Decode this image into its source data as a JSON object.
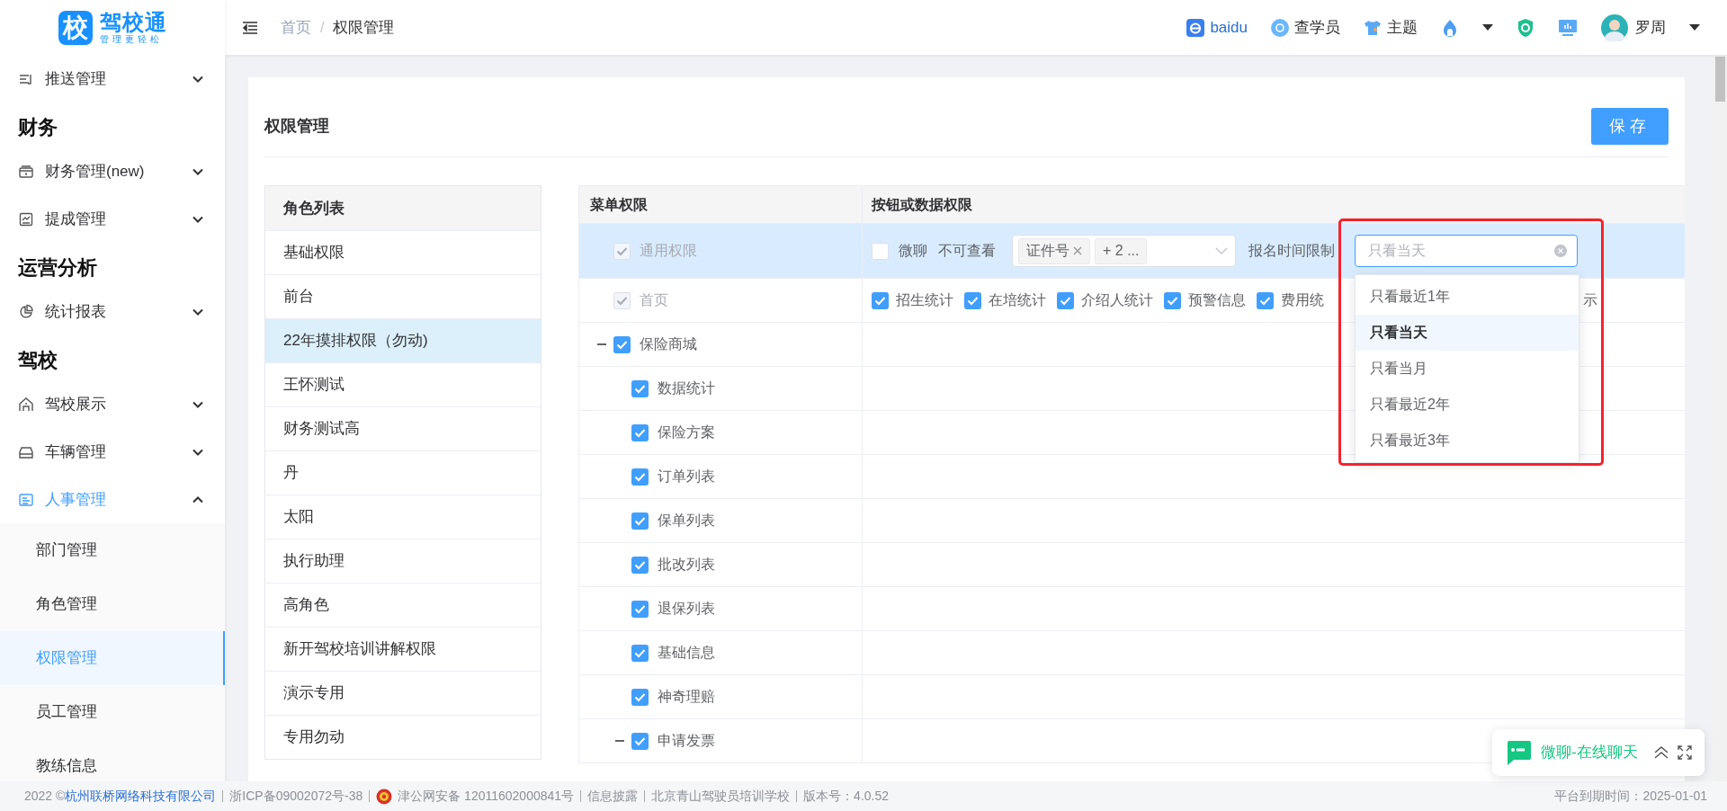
{
  "logo": {
    "mark": "校",
    "name": "驾校通",
    "tagline": "管理更轻松"
  },
  "header": {
    "breadcrumb": [
      "首页",
      "权限管理"
    ],
    "breadcrumb_separator": "/",
    "links": [
      {
        "label": "baidu",
        "kind": "link"
      },
      {
        "label": "查学员",
        "kind": "action"
      },
      {
        "label": "主题",
        "kind": "action"
      }
    ],
    "user": {
      "name": "罗周"
    }
  },
  "sidebar": {
    "sections": [
      {
        "items": [
          {
            "label": "推送管理",
            "expanded": false
          }
        ]
      },
      {
        "title": "财务",
        "items": [
          {
            "label": "财务管理(new)",
            "expanded": false
          },
          {
            "label": "提成管理",
            "expanded": false
          }
        ]
      },
      {
        "title": "运营分析",
        "items": [
          {
            "label": "统计报表",
            "expanded": false
          }
        ]
      },
      {
        "title": "驾校",
        "items": [
          {
            "label": "驾校展示",
            "expanded": false
          },
          {
            "label": "车辆管理",
            "expanded": false
          },
          {
            "label": "人事管理",
            "expanded": true,
            "children": [
              {
                "label": "部门管理",
                "selected": false
              },
              {
                "label": "角色管理",
                "selected": false
              },
              {
                "label": "权限管理",
                "selected": true
              },
              {
                "label": "员工管理",
                "selected": false
              },
              {
                "label": "教练信息",
                "selected": false
              }
            ]
          }
        ]
      }
    ]
  },
  "page": {
    "title": "权限管理",
    "save_button": "保存"
  },
  "roles": {
    "title": "角色列表",
    "items": [
      {
        "label": "基础权限",
        "selected": false
      },
      {
        "label": "前台",
        "selected": false
      },
      {
        "label": "22年摸排权限（勿动)",
        "selected": true
      },
      {
        "label": "王怀测试",
        "selected": false
      },
      {
        "label": "财务测试高",
        "selected": false
      },
      {
        "label": "丹",
        "selected": false
      },
      {
        "label": "太阳",
        "selected": false
      },
      {
        "label": "执行助理",
        "selected": false
      },
      {
        "label": "高角色",
        "selected": false
      },
      {
        "label": "新开驾校培训讲解权限",
        "selected": false
      },
      {
        "label": "演示专用",
        "selected": false
      },
      {
        "label": "专用勿动",
        "selected": false
      }
    ]
  },
  "permission_table": {
    "columns": [
      "菜单权限",
      "按钮或数据权限"
    ],
    "rows": [
      {
        "label": "通用权限",
        "checked": true,
        "disabled": true,
        "highlighted": true,
        "permissions": {
          "kind": "filters",
          "chat": {
            "label": "微聊",
            "checked": false
          },
          "hidden_fields": {
            "label": "不可查看",
            "tags": [
              {
                "text": "证件号",
                "closable": true
              },
              {
                "text": "+ 2 ...",
                "closable": false
              }
            ]
          },
          "time_limit": {
            "label": "报名时间限制",
            "placeholder": "只看当天",
            "options": [
              {
                "label": "只看最近1年",
                "selected": false
              },
              {
                "label": "只看当天",
                "selected": true
              },
              {
                "label": "只看当月",
                "selected": false
              },
              {
                "label": "只看最近2年",
                "selected": false
              },
              {
                "label": "只看最近3年",
                "selected": false
              }
            ]
          }
        }
      },
      {
        "label": "首页",
        "checked": true,
        "disabled": true,
        "highlighted": false,
        "permissions": {
          "kind": "checkboxes",
          "items": [
            {
              "label": "招生统计",
              "checked": true
            },
            {
              "label": "在培统计",
              "checked": true
            },
            {
              "label": "介绍人统计",
              "checked": true
            },
            {
              "label": "预警信息",
              "checked": true
            },
            {
              "label": "费用统",
              "checked": true
            }
          ],
          "trailing": "示"
        }
      },
      {
        "label": "保险商城",
        "checked": true,
        "disabled": false,
        "highlighted": false,
        "expanded": true,
        "children": [
          {
            "label": "数据统计",
            "checked": true
          },
          {
            "label": "保险方案",
            "checked": true
          },
          {
            "label": "订单列表",
            "checked": true
          },
          {
            "label": "保单列表",
            "checked": true
          },
          {
            "label": "批改列表",
            "checked": true
          },
          {
            "label": "退保列表",
            "checked": true
          },
          {
            "label": "基础信息",
            "checked": true
          },
          {
            "label": "神奇理赔",
            "checked": true
          },
          {
            "label": "申请发票",
            "checked": true,
            "expanded": true
          }
        ]
      }
    ]
  },
  "footer": {
    "copyright": "2022 ©",
    "company": "杭州联桥网络科技有限公司",
    "items": [
      "浙ICP备09002072号-38",
      "津公网安备 12011602000841号",
      "信息披露",
      "北京青山驾驶员培训学校",
      "版本号：4.0.52"
    ],
    "expiry": "平台到期时间：2025-01-01"
  },
  "chat_widget": {
    "label": "微聊-在线聊天"
  }
}
